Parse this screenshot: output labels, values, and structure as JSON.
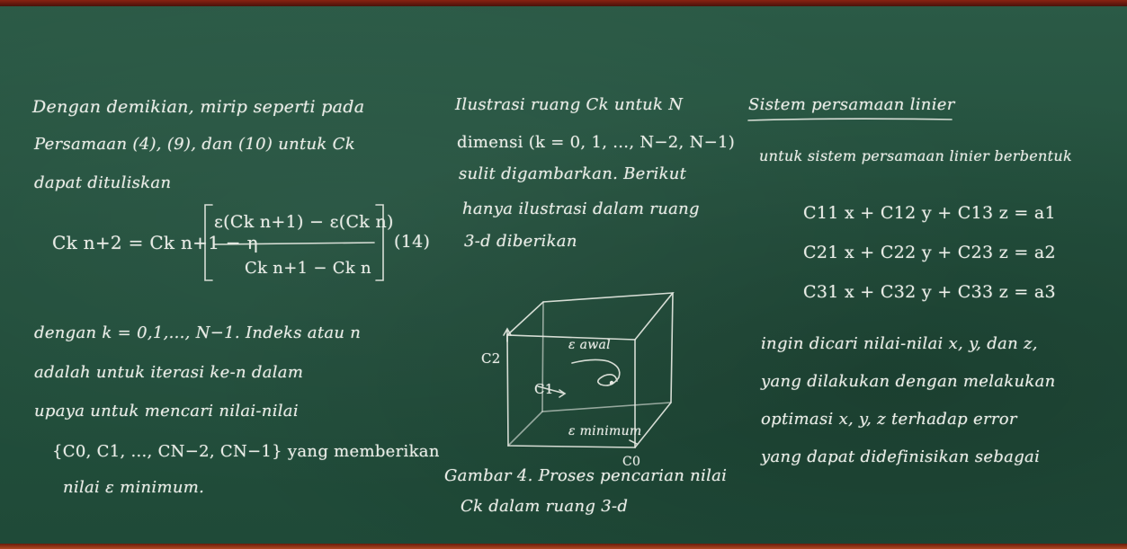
{
  "left_column": {
    "line1": "Dengan demikian, mirip seperti pada",
    "line2": "Persamaan (4), (9), dan (10) untuk Ck",
    "line3": "dapat dituliskan",
    "eq_lhs": "Ck n+2 = Ck n+1 − η",
    "eq_numerator": "ε(Ck n+1) − ε(Ck n)",
    "eq_denominator": "Ck n+1 − Ck n",
    "eq_number": "(14)",
    "line4": "dengan k = 0,1,..., N−1. Indeks atau n",
    "line5": "adalah untuk iterasi ke-n dalam",
    "line6": "upaya untuk mencari nilai-nilai",
    "line7": "{C0, C1, ..., CN−2, CN−1} yang memberikan",
    "line8": "nilai ε minimum."
  },
  "middle_column": {
    "line1": "Ilustrasi ruang Ck untuk N",
    "line2": "dimensi (k = 0, 1, ..., N−2, N−1)",
    "line3": "sulit digambarkan. Berikut",
    "line4": "hanya ilustrasi dalam ruang",
    "line5": "3-d diberikan",
    "diagram_axis_c2": "C2",
    "diagram_axis_c1": "C1",
    "diagram_axis_c0": "C0",
    "diagram_label_awal": "ε awal",
    "diagram_label_min": "ε minimum",
    "caption1": "Gambar 4. Proses pencarian nilai",
    "caption2": "Ck dalam ruang 3-d"
  },
  "right_column": {
    "line1": "Sistem persamaan linier",
    "line2": "untuk sistem persamaan linier berbentuk",
    "eq1": "C11 x + C12 y + C13 z = a1",
    "eq2": "C21 x + C22 y + C23 z = a2",
    "eq3": "C31 x + C32 y + C33 z = a3",
    "line3": "ingin dicari nilai-nilai x, y, dan z,",
    "line4": "yang dilakukan dengan melakukan",
    "line5": "optimasi x, y, z terhadap error",
    "line6": "yang dapat didefinisikan sebagai"
  }
}
